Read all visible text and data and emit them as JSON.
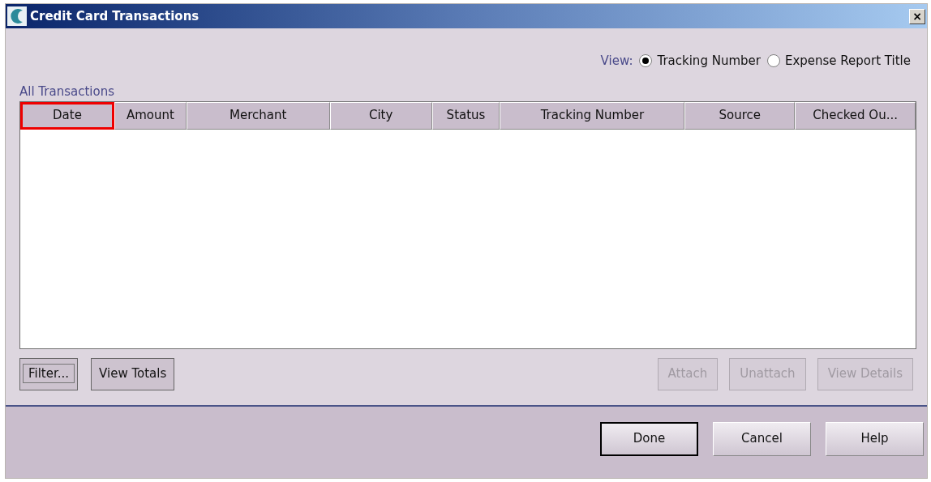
{
  "window": {
    "title": "Credit Card Transactions",
    "close": "×"
  },
  "view": {
    "label": "View:",
    "options": [
      {
        "label": "Tracking Number",
        "selected": true
      },
      {
        "label": "Expense Report Title",
        "selected": false
      }
    ]
  },
  "table": {
    "title": "All Transactions",
    "columns": [
      {
        "label": "Date",
        "highlighted": true
      },
      {
        "label": "Amount",
        "highlighted": false
      },
      {
        "label": "Merchant",
        "highlighted": false
      },
      {
        "label": "City",
        "highlighted": false
      },
      {
        "label": "Status",
        "highlighted": false
      },
      {
        "label": "Tracking Number",
        "highlighted": false
      },
      {
        "label": "Source",
        "highlighted": false
      },
      {
        "label": "Checked Ou...",
        "highlighted": false
      }
    ]
  },
  "left_buttons": [
    {
      "label": "Filter...",
      "focused": true,
      "disabled": false
    },
    {
      "label": "View Totals",
      "focused": false,
      "disabled": false
    }
  ],
  "right_buttons": [
    {
      "label": "Attach",
      "disabled": true
    },
    {
      "label": "Unattach",
      "disabled": true
    },
    {
      "label": "View Details",
      "disabled": true
    }
  ],
  "footer_buttons": [
    {
      "label": "Done",
      "default": true
    },
    {
      "label": "Cancel",
      "default": false
    },
    {
      "label": "Help",
      "default": false
    }
  ]
}
